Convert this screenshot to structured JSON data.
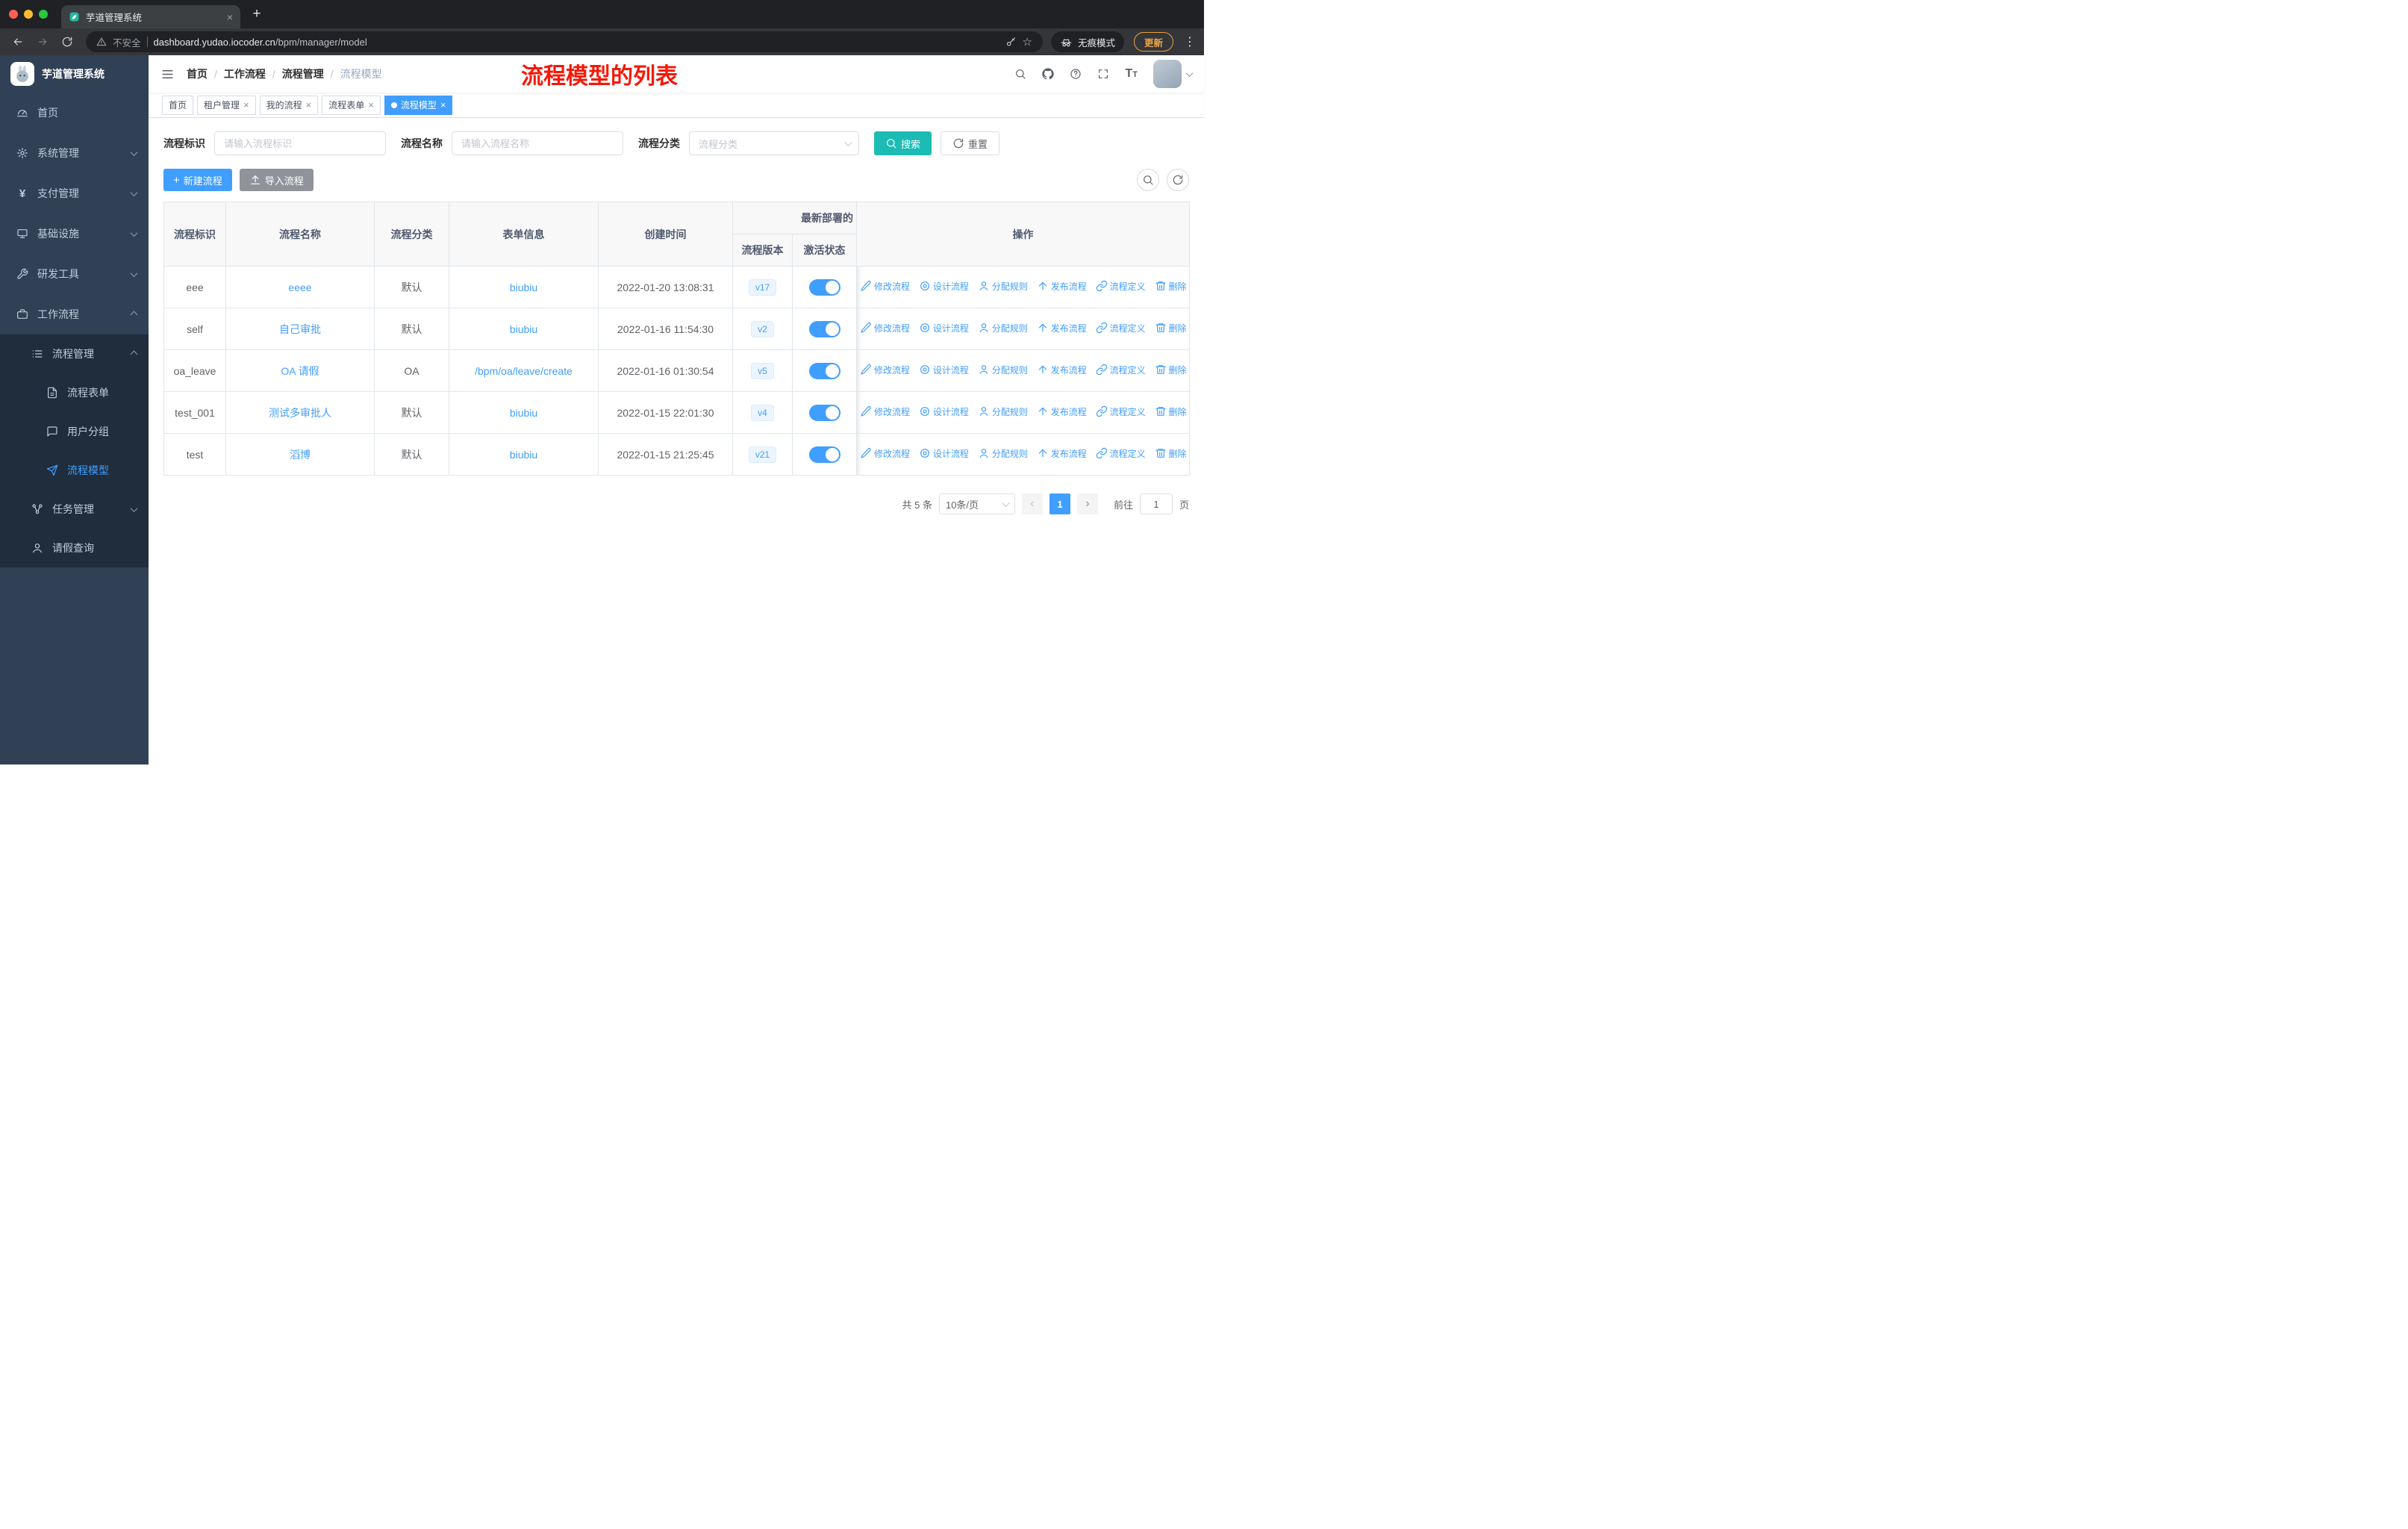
{
  "browser": {
    "tab_title": "芋道管理系统",
    "security_label": "不安全",
    "url_host": "dashboard.yudao.iocoder.cn",
    "url_path": "/bpm/manager/model",
    "incognito_label": "无痕模式",
    "update_button": "更新"
  },
  "sidebar": {
    "app_title": "芋道管理系统",
    "items": [
      {
        "label": "首页"
      },
      {
        "label": "系统管理"
      },
      {
        "label": "支付管理"
      },
      {
        "label": "基础设施"
      },
      {
        "label": "研发工具"
      },
      {
        "label": "工作流程"
      },
      {
        "label": "流程管理"
      },
      {
        "label": "流程表单"
      },
      {
        "label": "用户分组"
      },
      {
        "label": "流程模型"
      },
      {
        "label": "任务管理"
      },
      {
        "label": "请假查询"
      }
    ]
  },
  "header": {
    "breadcrumb": [
      "首页",
      "工作流程",
      "流程管理",
      "流程模型"
    ],
    "annotation": "流程模型的列表"
  },
  "tags": [
    {
      "label": "首页",
      "closable": false,
      "active": false
    },
    {
      "label": "租户管理",
      "closable": true,
      "active": false
    },
    {
      "label": "我的流程",
      "closable": true,
      "active": false
    },
    {
      "label": "流程表单",
      "closable": true,
      "active": false
    },
    {
      "label": "流程模型",
      "closable": true,
      "active": true
    }
  ],
  "filters": {
    "key_label": "流程标识",
    "key_placeholder": "请输入流程标识",
    "name_label": "流程名称",
    "name_placeholder": "请输入流程名称",
    "category_label": "流程分类",
    "category_placeholder": "流程分类",
    "search_button": "搜索",
    "reset_button": "重置"
  },
  "toolbar": {
    "create_button": "新建流程",
    "import_button": "导入流程"
  },
  "table": {
    "headers": {
      "key": "流程标识",
      "name": "流程名称",
      "category": "流程分类",
      "form": "表单信息",
      "create_time": "创建时间",
      "deploy_group": "最新部署的",
      "version": "流程版本",
      "active": "激活状态",
      "actions": "操作"
    },
    "row_actions": [
      {
        "label": "修改流程"
      },
      {
        "label": "设计流程"
      },
      {
        "label": "分配规则"
      },
      {
        "label": "发布流程"
      },
      {
        "label": "流程定义"
      },
      {
        "label": "删除"
      }
    ],
    "rows": [
      {
        "id": "eee",
        "name": "eeee",
        "category": "默认",
        "form": "biubiu",
        "time": "2022-01-20 13:08:31",
        "version": "v17",
        "active": true
      },
      {
        "id": "self",
        "name": "自己审批",
        "category": "默认",
        "form": "biubiu",
        "time": "2022-01-16 11:54:30",
        "version": "v2",
        "active": true
      },
      {
        "id": "oa_leave",
        "name": "OA 请假",
        "category": "OA",
        "form": "/bpm/oa/leave/create",
        "time": "2022-01-16 01:30:54",
        "version": "v5",
        "active": true
      },
      {
        "id": "test_001",
        "name": "测试多审批人",
        "category": "默认",
        "form": "biubiu",
        "time": "2022-01-15 22:01:30",
        "version": "v4",
        "active": true
      },
      {
        "id": "test",
        "name": "滔博",
        "category": "默认",
        "form": "biubiu",
        "time": "2022-01-15 21:25:45",
        "version": "v21",
        "active": true
      }
    ]
  },
  "pagination": {
    "total": "共 5 条",
    "page_size": "10条/页",
    "current_page": "1",
    "goto_label": "前往",
    "goto_value": "1",
    "page_unit": "页"
  },
  "colors": {
    "accent": "#409EFF",
    "search": "#1CBBB4",
    "info": "#909399",
    "red": "#F5190A",
    "sidebar": "#304156",
    "submenu": "#1F2D3D"
  }
}
